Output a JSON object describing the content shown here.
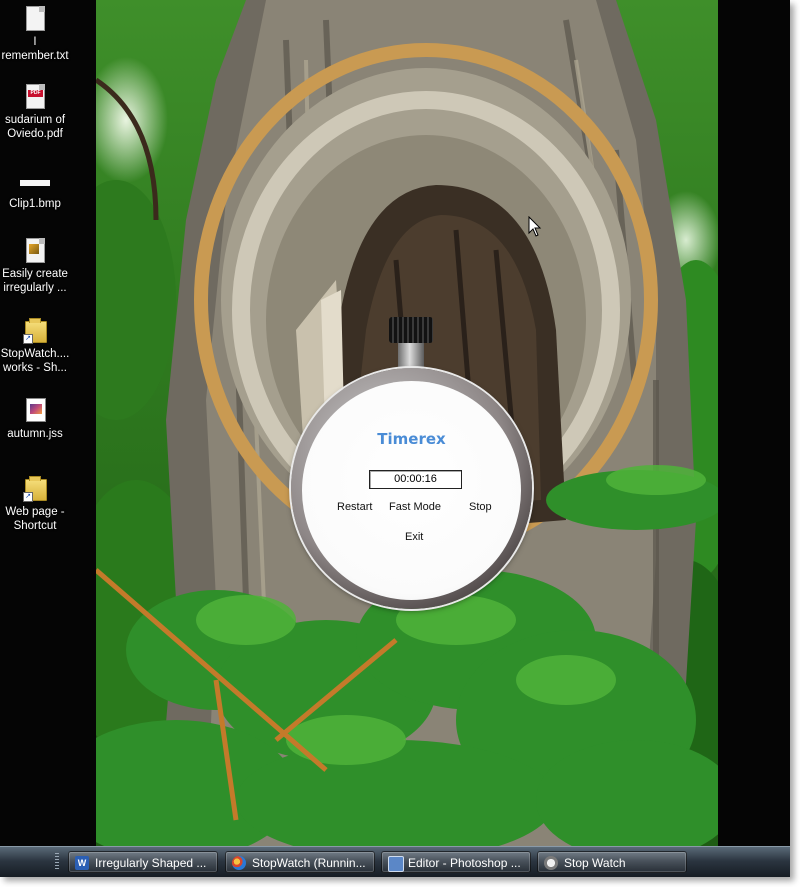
{
  "desktop": {
    "icons": [
      {
        "label": "I\nremember.txt",
        "icon": "text-file-icon"
      },
      {
        "label": "sudarium of\nOviedo.pdf",
        "icon": "pdf-file-icon"
      },
      {
        "label": "Clip1.bmp",
        "icon": "bitmap-file-icon"
      },
      {
        "label": "Easily create\nirregularly ...",
        "icon": "document-file-icon"
      },
      {
        "label": "StopWatch....\nworks - Sh...",
        "icon": "folder-shortcut-icon"
      },
      {
        "label": "autumn.jss",
        "icon": "image-file-icon"
      },
      {
        "label": "Web page -\nShortcut",
        "icon": "folder-shortcut-icon"
      }
    ]
  },
  "stopwatch": {
    "title": "Timerex",
    "time": "00:00:16",
    "buttons": {
      "restart": "Restart",
      "fast_mode": "Fast Mode",
      "stop": "Stop",
      "exit": "Exit"
    },
    "title_color": "#4a8cd6"
  },
  "taskbar": {
    "buttons": [
      {
        "label": "Irregularly Shaped ...",
        "icon": "word-document-icon",
        "icon_glyph": "W"
      },
      {
        "label": "StopWatch (Runnin...",
        "icon": "visual-studio-icon"
      },
      {
        "label": "Editor - Photoshop ...",
        "icon": "editor-window-icon"
      },
      {
        "label": "Stop Watch",
        "icon": "stopwatch-icon"
      }
    ]
  }
}
